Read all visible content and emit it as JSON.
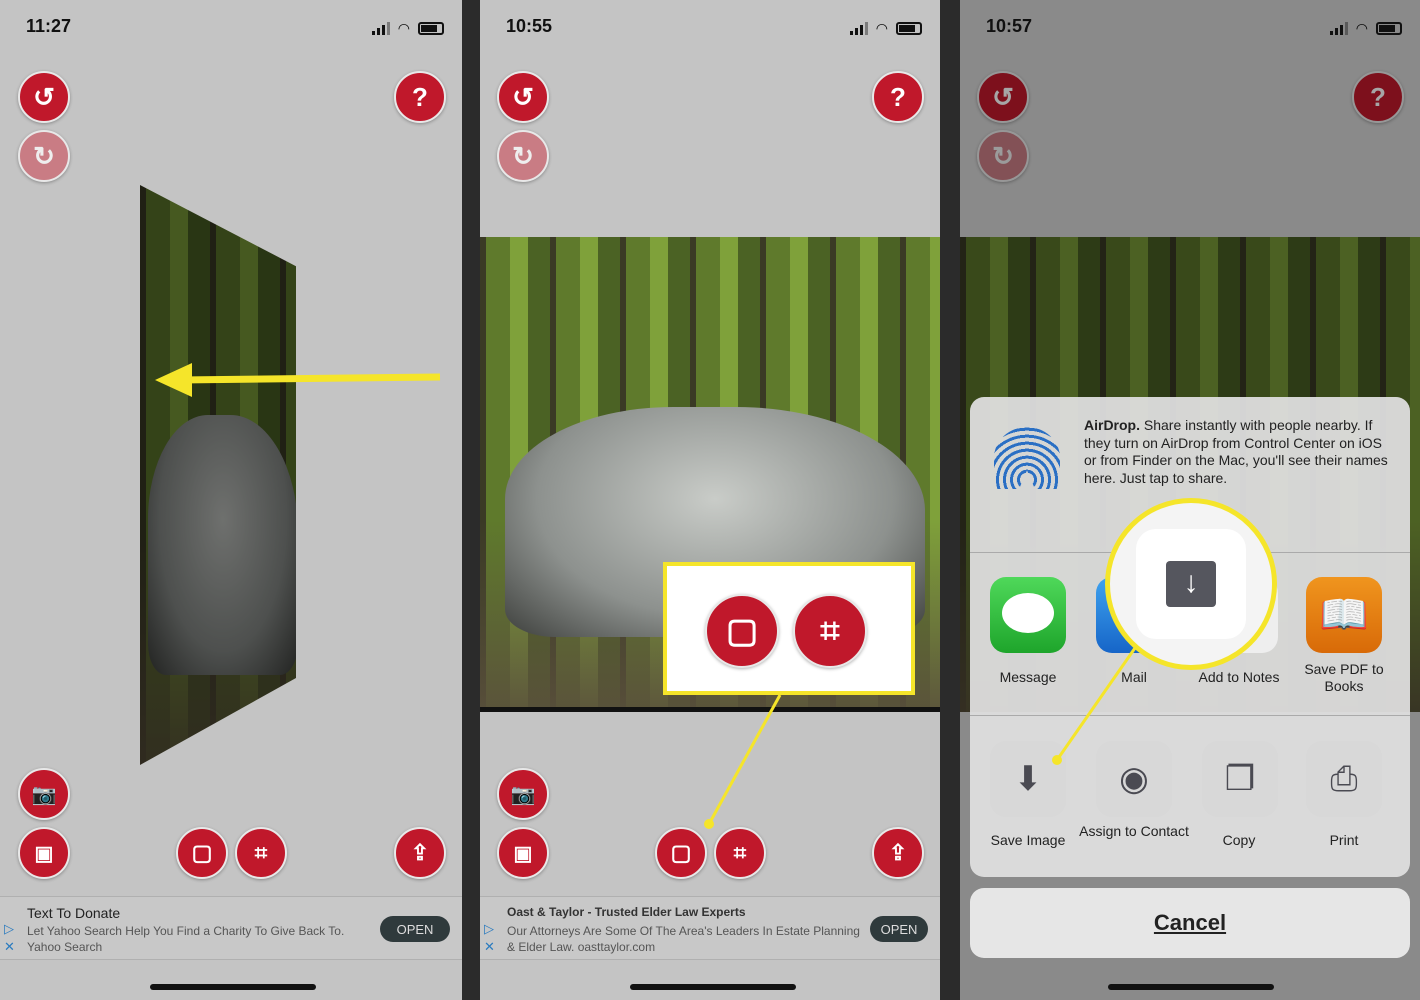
{
  "panels": [
    {
      "time": "11:27",
      "ad": {
        "title": "Text To Donate",
        "desc": "Let Yahoo Search Help You Find a Charity To Give Back To.",
        "sponsor": "Yahoo Search",
        "open": "OPEN"
      }
    },
    {
      "time": "10:55",
      "ad": {
        "title": "Oast & Taylor - Trusted Elder Law Experts",
        "desc": "Our Attorneys Are Some Of The Area's Leaders In Estate Planning & Elder Law. oasttaylor.com",
        "open": "OPEN"
      }
    },
    {
      "time": "10:57"
    }
  ],
  "buttons": {
    "help": "?"
  },
  "share_sheet": {
    "airdrop_title": "AirDrop.",
    "airdrop_text": " Share instantly with people nearby. If they turn on AirDrop from Control Center on iOS or from Finder on the Mac, you'll see their names here. Just tap to share.",
    "apps": [
      "Message",
      "Mail",
      "Add to Notes",
      "Save PDF to Books"
    ],
    "actions": [
      "Save Image",
      "Assign to Contact",
      "Copy",
      "Print"
    ],
    "cancel": "Cancel"
  },
  "colors": {
    "accent_red": "#c0182b",
    "highlight_yellow": "#f5e52a",
    "message_green": "#2fb83a",
    "books_orange": "#e07a10",
    "airdrop_blue": "#2a6fc4"
  }
}
